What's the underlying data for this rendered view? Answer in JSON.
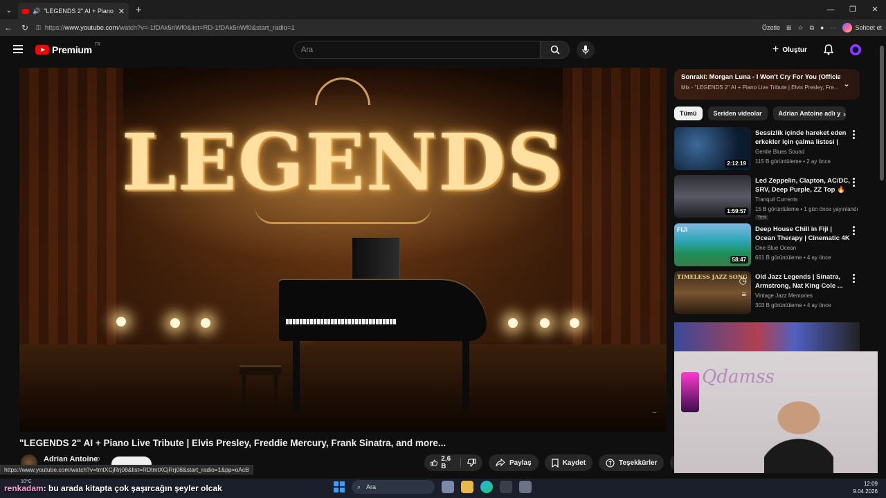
{
  "browser": {
    "tab_title": "\"LEGENDS 2\" AI + Piano Live",
    "url_prefix": "https://",
    "url_host": "www.youtube.com",
    "url_path": "/watch?v=-1fDAk5nWf0&list=RD-1fDAk5nWf0&start_radio=1",
    "summarize_label": "Özetle",
    "chat_label": "Sohbet et",
    "status_url": "https://www.youtube.com/watch?v=tmtXCjRrj08&list=RDtmtXCjRrj08&start_radio=1&pp=oAcB"
  },
  "header": {
    "logo_text": "Premium",
    "country_code": "TR",
    "search_placeholder": "Ara",
    "create_label": "Oluştur"
  },
  "video": {
    "overlay_title": "LEGENDS",
    "title": "\"LEGENDS 2\" AI + Piano Live Tribute | Elvis Presley, Freddie Mercury, Frank Sinatra, and more...",
    "channel": "Adrian Antoine",
    "likes": "2,6 B",
    "share_label": "Paylaş",
    "save_label": "Kaydet",
    "thanks_label": "Teşekkürler"
  },
  "mix": {
    "next": "Sonraki: Morgan Luna - I Won't Cry For You (Official...",
    "sub": "Mix - \"LEGENDS 2\" AI + Piano Live Tribute | Elvis Presley, Fre..."
  },
  "chips": [
    "Tümü",
    "Seriden videolar",
    "Adrian Antoine adlı y"
  ],
  "recommendations": [
    {
      "title": "Sessizlik içinde hareket eden erkekler için çalma listesi | Vis...",
      "channel": "Gentle Blues Sound",
      "meta": "115 B görüntüleme • 2 ay önce",
      "duration": "2:12:19",
      "badge": ""
    },
    {
      "title": "Led Zeppelin, Clapton, AC/DC, SRV, Deep Purple, ZZ Top 🔥 ...",
      "channel": "Tranquil Currents",
      "meta": "15 B görüntüleme • 1 gün önce yayınlandı",
      "duration": "1:59:57",
      "badge": "Yeni"
    },
    {
      "title": "Deep House Chill in Fiji | Ocean Therapy | Cinematic 4K Aerial ...",
      "channel": "One Blue Ocean",
      "meta": "661 B görüntüleme • 4 ay önce",
      "duration": "58:47",
      "badge": ""
    },
    {
      "title": "Old Jazz Legends | Sinatra, Armstrong, Nat King Cole ...",
      "channel": "Vintage Jazz Memories",
      "meta": "303 B görüntüleme • 4 ay önce",
      "duration": "",
      "badge": ""
    }
  ],
  "thumb_texts": {
    "fiji": "FIJI",
    "jazz": "TIMELESS JAZZ SONG"
  },
  "webcam": {
    "sign_text": "Qdamss"
  },
  "taskbar": {
    "weather": "10°C",
    "search_label": "Ara",
    "time": "12:09",
    "date": "9.04.2026"
  },
  "chat": {
    "user": "renkadam",
    "message": ": bu arada kitapta çok şaşırcağın şeyler olcak"
  },
  "colors": {
    "background": "#0f0f0f",
    "brand_red": "#ff0000",
    "accent_gold": "#ffe0a0"
  }
}
